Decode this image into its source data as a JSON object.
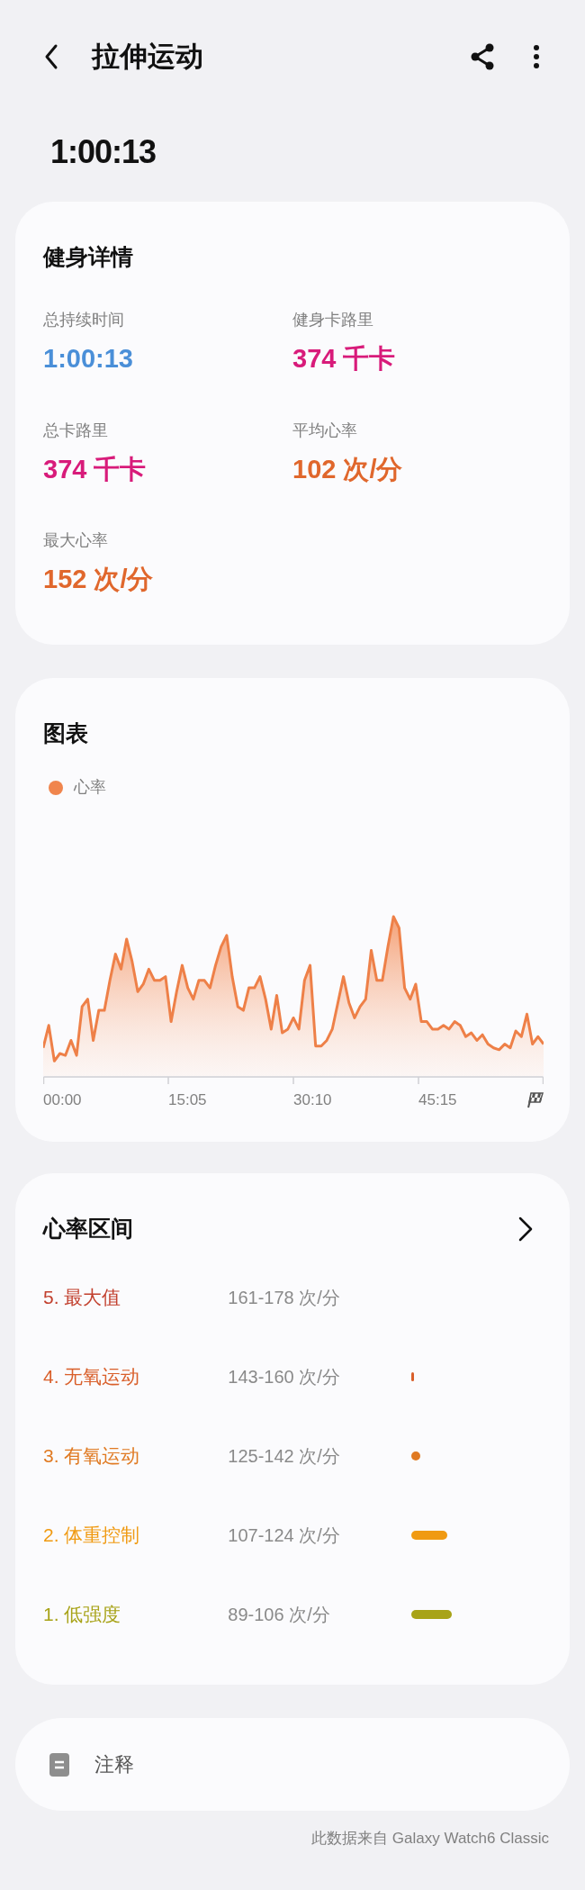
{
  "header": {
    "title": "拉伸运动"
  },
  "summary_time": "1:00:13",
  "details": {
    "title": "健身详情",
    "stats": [
      {
        "label": "总持续时间",
        "value": "1:00:13",
        "kind": "duration"
      },
      {
        "label": "健身卡路里",
        "value": "374 千卡",
        "kind": "calories"
      },
      {
        "label": "总卡路里",
        "value": "374 千卡",
        "kind": "calories"
      },
      {
        "label": "平均心率",
        "value": "102 次/分",
        "kind": "heart_rate"
      },
      {
        "label": "最大心率",
        "value": "152 次/分",
        "kind": "heart_rate"
      }
    ]
  },
  "chart": {
    "title": "图表",
    "legend": "心率",
    "axis_labels": [
      "00:00",
      "15:05",
      "30:10",
      "45:15"
    ]
  },
  "zones": {
    "title": "心率区间",
    "items": [
      {
        "name": "5. 最大值",
        "range": "161-178 次/分",
        "color": "#c2402e"
      },
      {
        "name": "4. 无氧运动",
        "range": "143-160 次/分",
        "color": "#d95f2a"
      },
      {
        "name": "3. 有氧运动",
        "range": "125-142 次/分",
        "color": "#e07a22"
      },
      {
        "name": "2. 体重控制",
        "range": "107-124 次/分",
        "color": "#f09a12"
      },
      {
        "name": "1. 低强度",
        "range": "89-106 次/分",
        "color": "#a8a318"
      }
    ]
  },
  "notes": {
    "label": "注释"
  },
  "source": "此数据来自 Galaxy Watch6 Classic"
}
